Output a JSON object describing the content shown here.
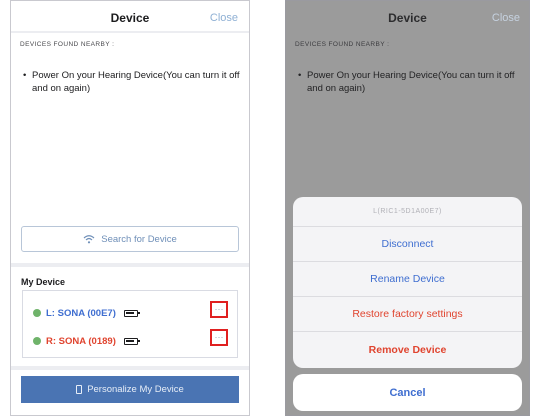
{
  "left_screen": {
    "nav": {
      "title": "Device",
      "close_label": "Close"
    },
    "section_label": "DEVICES FOUND NEARBY :",
    "instruction": "Power On your Hearing Device(You can turn it off and on again)",
    "search_button": {
      "label": "Search for Device",
      "icon": "wifi-icon"
    },
    "my_device": {
      "title": "My Device",
      "devices": [
        {
          "label": "L: SONA (00E7)",
          "color": "#3f6ed0",
          "status_color": "#6fb36a",
          "icon": "battery-icon",
          "more_label": "···"
        },
        {
          "label": "R: SONA (0189)",
          "color": "#e0442f",
          "status_color": "#6fb36a",
          "icon": "battery-icon",
          "more_label": "···"
        }
      ]
    },
    "primary_button": {
      "label": "Personalize My Device",
      "icon": "phone-icon",
      "color": "#4a74b3"
    }
  },
  "right_screen": {
    "nav": {
      "title": "Device",
      "close_label": "Close"
    },
    "section_label": "DEVICES FOUND NEARBY :",
    "instruction": "Power On your Hearing Device(You can turn it off and on again)",
    "action_sheet": {
      "header": "L(RIC1-5D1A00E7)",
      "items": [
        {
          "label": "Disconnect",
          "color": "#3f6ed0"
        },
        {
          "label": "Rename Device",
          "color": "#3f6ed0"
        },
        {
          "label": "Restore factory settings",
          "color": "#e0442f"
        },
        {
          "label": "Remove Device",
          "color": "#e0442f"
        }
      ],
      "cancel_label": "Cancel"
    }
  }
}
